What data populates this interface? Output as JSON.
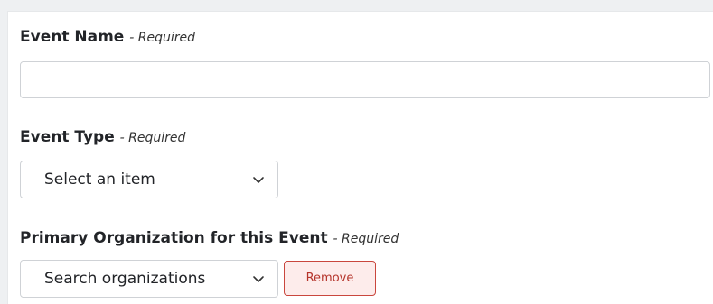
{
  "form": {
    "event_name": {
      "label": "Event Name",
      "required": "- Required",
      "value": "",
      "placeholder": ""
    },
    "event_type": {
      "label": "Event Type",
      "required": "- Required",
      "selected": "Select an item",
      "icon": "chevron-down-icon"
    },
    "primary_org": {
      "label": "Primary Organization for this Event",
      "required": "- Required",
      "selected": "Search organizations",
      "icon": "chevron-down-icon",
      "remove_label": "Remove"
    }
  },
  "colors": {
    "remove_border": "#c9463d",
    "remove_bg": "#fdeceb",
    "remove_text": "#b5342b"
  }
}
